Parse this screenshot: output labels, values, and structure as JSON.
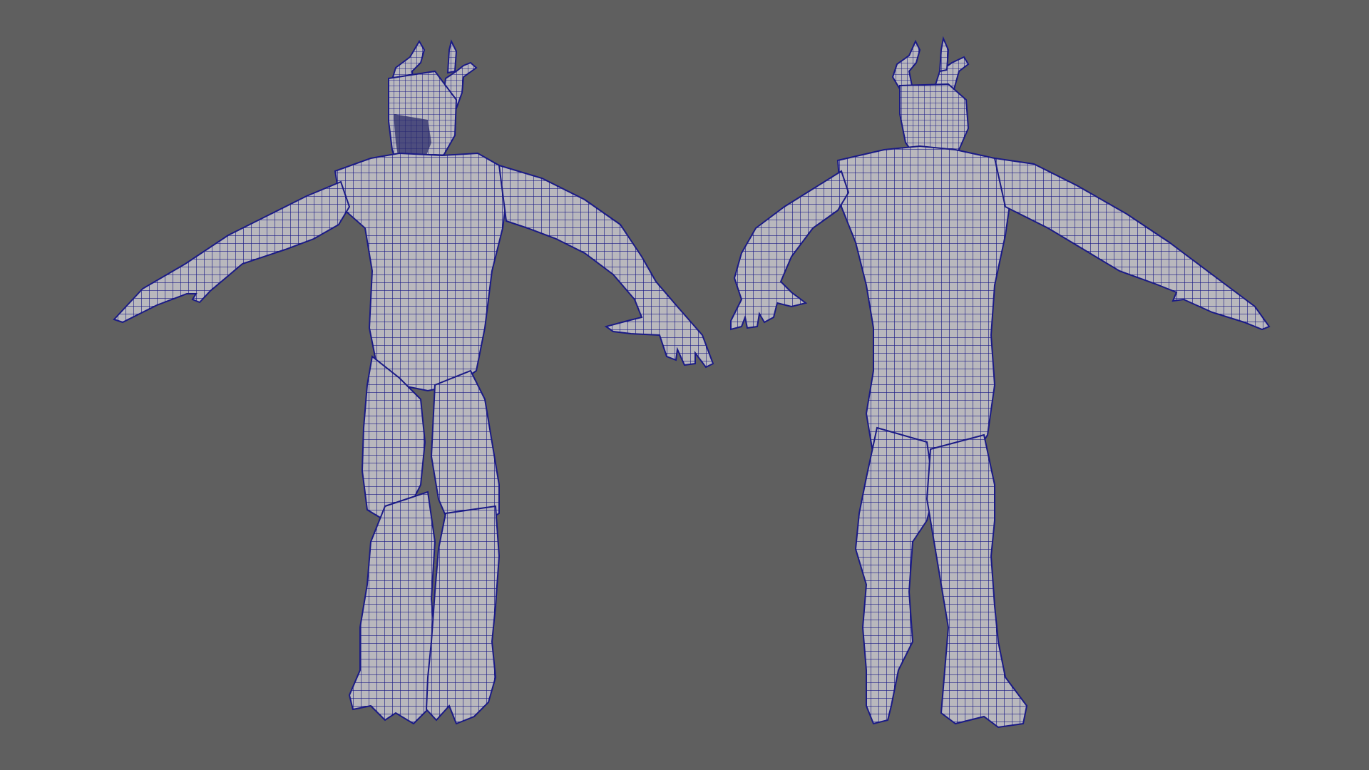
{
  "viewport": {
    "background_color": "#5f5f5f",
    "panel": "perspective",
    "display_mode": "wireframe-on-shaded"
  },
  "scene": {
    "mesh_surface_color": "#b9b8bd",
    "wireframe_color": "#1a1a86",
    "models": [
      {
        "view": "front",
        "icon": "creature-front-mesh-icon"
      },
      {
        "view": "back",
        "icon": "creature-back-mesh-icon"
      }
    ]
  }
}
